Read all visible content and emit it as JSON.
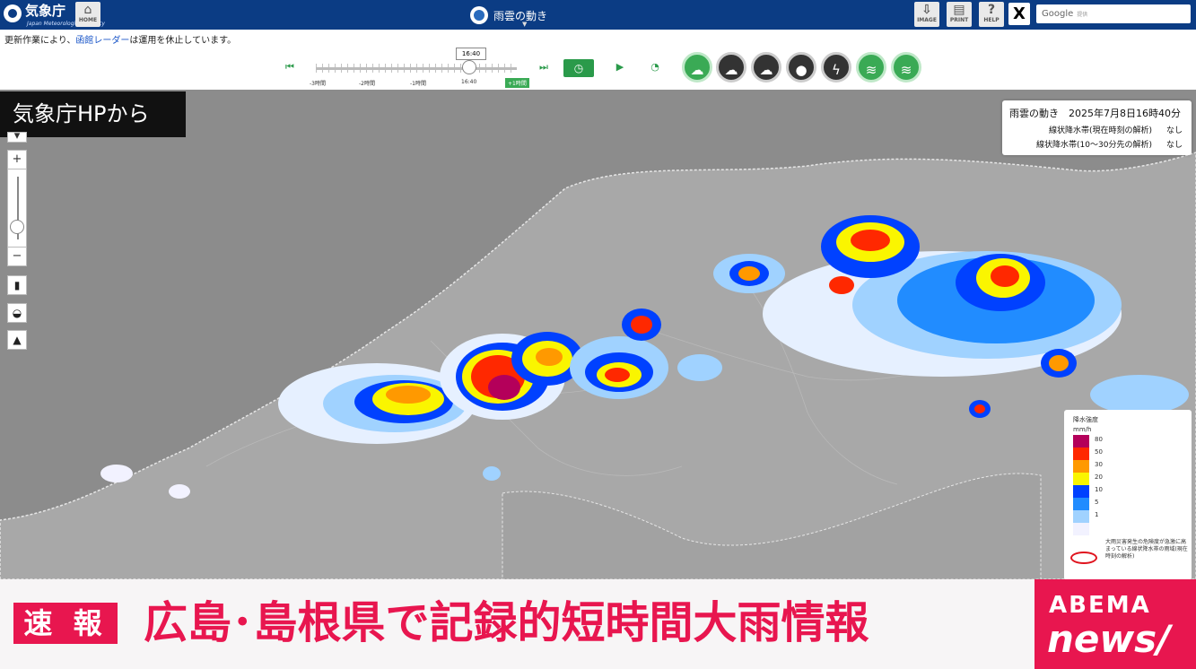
{
  "header": {
    "logo_title": "気象庁",
    "logo_subtitle": "Japan Meteorological Agency",
    "home_label": "HOME",
    "page_title": "雨雲の動き",
    "image_label": "IMAGE",
    "print_label": "PRINT",
    "help_label": "HELP",
    "x_label": "X",
    "search_placeholder": "Google",
    "search_sub": "提供"
  },
  "notice": {
    "before": "更新作業により、",
    "link": "函館レーダー",
    "after": "は運用を休止しています。"
  },
  "timeline": {
    "current_time": "16:40",
    "labels": [
      "-3時間",
      "-2時間",
      "-1時間",
      "16:40"
    ],
    "now_label": "+1時間"
  },
  "map_caption": "気象庁HPから",
  "info_panel": {
    "title": "雨雲の動き　2025年7月8日16時40分",
    "rows": [
      {
        "label": "線状降水帯(現在時刻の解析)",
        "value": "なし"
      },
      {
        "label": "線状降水帯(10～30分先の解析)",
        "value": "なし"
      }
    ]
  },
  "legend": {
    "title": "降水強度",
    "unit": "mm/h",
    "levels": [
      {
        "label": "80",
        "color": "#b4005a"
      },
      {
        "label": "50",
        "color": "#ff2800"
      },
      {
        "label": "30",
        "color": "#ff9900"
      },
      {
        "label": "20",
        "color": "#faf500"
      },
      {
        "label": "10",
        "color": "#0041ff"
      },
      {
        "label": "5",
        "color": "#218cff"
      },
      {
        "label": "1",
        "color": "#a0d2ff"
      },
      {
        "label": "",
        "color": "#f2f2ff"
      }
    ],
    "note": "大雨災害発生の危険度が急激に高まっている線状降水帯の雨域(現在時刻の解析)"
  },
  "news": {
    "badge": "速 報",
    "headline": "広島･島根県で記録的短時間大雨情報",
    "brand_top": "ABEMA",
    "brand_bottom": "news/"
  },
  "colors": {
    "header_bg": "#0b3c84",
    "accent_green": "#2a9a4a",
    "news_red": "#e8164f",
    "map_bg": "#9a9a9a"
  }
}
